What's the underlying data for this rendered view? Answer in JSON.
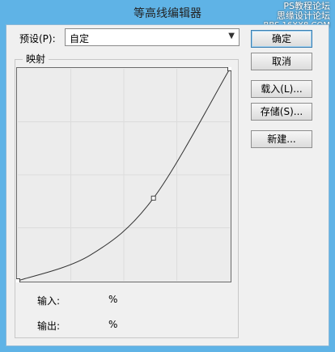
{
  "window": {
    "title": "等高线编辑器",
    "watermark_line1": "思缘设计论坛",
    "watermark_badge": "PS教程论坛",
    "watermark_line2": "BBS.16XX8.COM"
  },
  "preset": {
    "label": "预设(P):",
    "value": "自定"
  },
  "buttons": {
    "ok": "确定",
    "cancel": "取消",
    "load": "载入(L)...",
    "save": "存储(S)...",
    "new": "新建..."
  },
  "mapping": {
    "title": "映射",
    "input_label": "输入:",
    "input_unit": "%",
    "output_label": "输出:",
    "output_unit": "%",
    "grid_divisions": 4,
    "curve_points": [
      {
        "input": 0,
        "output": 0
      },
      {
        "input": 34,
        "output": 12
      },
      {
        "input": 64,
        "output": 39
      },
      {
        "input": 100,
        "output": 100
      }
    ]
  },
  "colors": {
    "titlebar": "#5fb3e6",
    "dialog_bg": "#f0f0f0",
    "grid_line": "#dcdcdc",
    "curve": "#333333"
  }
}
